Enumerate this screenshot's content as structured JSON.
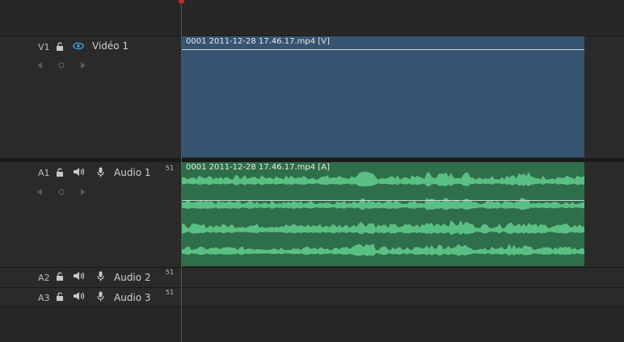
{
  "tracks": {
    "video1": {
      "code": "V1",
      "name": "Vidéo 1",
      "clip_label": "0001 2011-12-28 17.46.17.mp4 [V]"
    },
    "audio1": {
      "code": "A1",
      "name": "Audio 1",
      "channels": "51",
      "clip_label": "0001 2011-12-28 17.46.17.mp4 [A]"
    },
    "audio2": {
      "code": "A2",
      "name": "Audio 2",
      "channels": "51"
    },
    "audio3": {
      "code": "A3",
      "name": "Audio 3",
      "channels": "51"
    }
  },
  "icons": {
    "lock": "lock-icon",
    "eye": "eye-icon",
    "speaker": "speaker-icon",
    "mic": "microphone-icon",
    "prev": "previous-keyframe-icon",
    "next": "next-keyframe-icon",
    "keyframe": "add-keyframe-icon"
  },
  "colors": {
    "video_clip": "#365470",
    "audio_clip": "#2f6e4a",
    "waveform": "#5fc88a",
    "playhead": "#c0282d",
    "eye_active": "#3a9ee0"
  }
}
